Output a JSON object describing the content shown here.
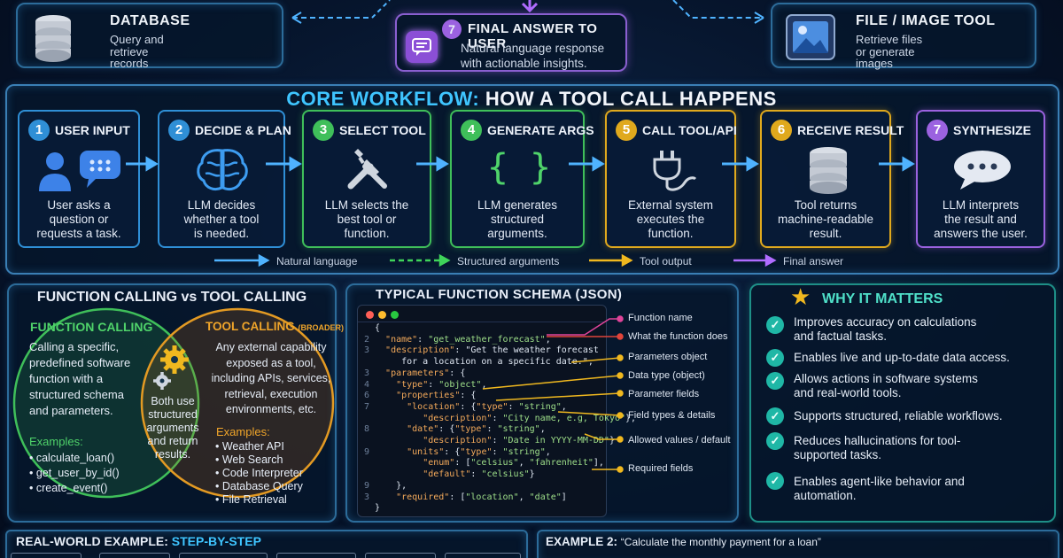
{
  "top": {
    "database": {
      "title": "DATABASE",
      "text": [
        "Query and",
        "retrieve",
        "records"
      ]
    },
    "final": {
      "num": "7",
      "title": "FINAL ANSWER TO USER",
      "text": [
        "Natural language response",
        "with actionable insights."
      ]
    },
    "file_tool": {
      "title": "FILE / IMAGE TOOL",
      "text": [
        "Retrieve files",
        "or generate",
        "images"
      ]
    }
  },
  "workflow": {
    "title_a": "CORE WORKFLOW:",
    "title_b": "HOW A TOOL CALL HAPPENS",
    "steps": [
      {
        "num": "1",
        "label": "USER INPUT",
        "desc": [
          "User asks a",
          "question or",
          "requests a task."
        ],
        "color": "#2f8fd6"
      },
      {
        "num": "2",
        "label": "DECIDE & PLAN",
        "desc": [
          "LLM decides",
          "whether a tool",
          "is needed."
        ],
        "color": "#2f8fd6"
      },
      {
        "num": "3",
        "label": "SELECT TOOL",
        "desc": [
          "LLM selects the",
          "best tool or",
          "function."
        ],
        "color": "#3fbf5a"
      },
      {
        "num": "4",
        "label": "GENERATE ARGS",
        "desc": [
          "LLM generates",
          "structured",
          "arguments."
        ],
        "color": "#3fbf5a"
      },
      {
        "num": "5",
        "label": "CALL TOOL/API",
        "desc": [
          "External system",
          "executes the",
          "function."
        ],
        "color": "#e0a91d"
      },
      {
        "num": "6",
        "label": "RECEIVE RESULT",
        "desc": [
          "Tool returns",
          "machine-readable",
          "result."
        ],
        "color": "#e0a91d"
      },
      {
        "num": "7",
        "label": "SYNTHESIZE",
        "desc": [
          "LLM interprets",
          "the result and",
          "answers the user."
        ],
        "color": "#9b62e0"
      }
    ],
    "legend": [
      "Natural language",
      "Structured arguments",
      "Tool output",
      "Final answer"
    ]
  },
  "fc_vs_tc": {
    "title": "FUNCTION CALLING vs TOOL CALLING",
    "fc_title": "FUNCTION CALLING",
    "fc_text": [
      "Calling a specific,",
      "predefined software",
      "function with a",
      "structured schema",
      "and parameters."
    ],
    "fc_examples_label": "Examples:",
    "fc_examples": [
      "calculate_loan()",
      "get_user_by_id()",
      "create_event()"
    ],
    "tc_title": "TOOL CALLING",
    "tc_tag": "(BROADER)",
    "tc_text": [
      "Any external capability",
      "exposed as a tool,",
      "including APIs, services,",
      "retrieval, execution",
      "environments, etc."
    ],
    "tc_examples_label": "Examples:",
    "tc_examples": [
      "Weather API",
      "Web Search",
      "Code Interpreter",
      "Database Query",
      "File Retrieval"
    ],
    "overlap": [
      "Both use",
      "structured",
      "arguments",
      "and return",
      "results."
    ]
  },
  "schema": {
    "title": "TYPICAL FUNCTION SCHEMA (JSON)",
    "lines": [
      {
        "n": "",
        "t": "{"
      },
      {
        "n": "2",
        "t": "  \"name\": \"get_weather_forecast\","
      },
      {
        "n": "3",
        "t": "  \"description\": \"Get the weather forecast"
      },
      {
        "n": "",
        "t": "     for a location on a specific date.\","
      },
      {
        "n": "3",
        "t": "  \"parameters\": {"
      },
      {
        "n": "4",
        "t": "    \"type\": \"object\","
      },
      {
        "n": "6",
        "t": "    \"properties\": {"
      },
      {
        "n": "7",
        "t": "      \"location\": {\"type\": \"string\","
      },
      {
        "n": "",
        "t": "         \"description\": \"City name, e.g, Tokyo\"},"
      },
      {
        "n": "8",
        "t": "      \"date\": {\"type\": \"string\","
      },
      {
        "n": "",
        "t": "         \"description\": \"Date in YYYY-MM-DD\"}"
      },
      {
        "n": "9",
        "t": "      \"units\": {\"type\": \"string\","
      },
      {
        "n": "",
        "t": "         \"enum\": [\"celsius\", \"fahrenheit\"],"
      },
      {
        "n": "",
        "t": "         \"default\": \"celsius\"}"
      },
      {
        "n": "9",
        "t": "    },"
      },
      {
        "n": "3",
        "t": "    \"required\": [\"location\", \"date\"]"
      },
      {
        "n": "",
        "t": "}"
      }
    ],
    "annotations": [
      "Function name",
      "What the function does",
      "Parameters object",
      "Data type (object)",
      "Parameter fields",
      "Field types & details",
      "Allowed values / default",
      "Required fields"
    ]
  },
  "why": {
    "title": "WHY IT MATTERS",
    "items": [
      [
        "Improves accuracy on calculations",
        "and factual tasks."
      ],
      [
        "Enables live and up-to-date data access."
      ],
      [
        "Allows actions in software systems",
        "and real-world tools."
      ],
      [
        "Supports structured, reliable workflows."
      ],
      [
        "Reduces hallucinations for tool-",
        "supported tasks."
      ],
      [
        "Enables agent-like behavior and",
        "automation."
      ]
    ]
  },
  "bottom": {
    "left_a": "REAL-WORLD EXAMPLE:",
    "left_b": "STEP-BY-STEP",
    "right_a": "EXAMPLE 2:",
    "right_b": "“Calculate the monthly payment for a loan”"
  }
}
